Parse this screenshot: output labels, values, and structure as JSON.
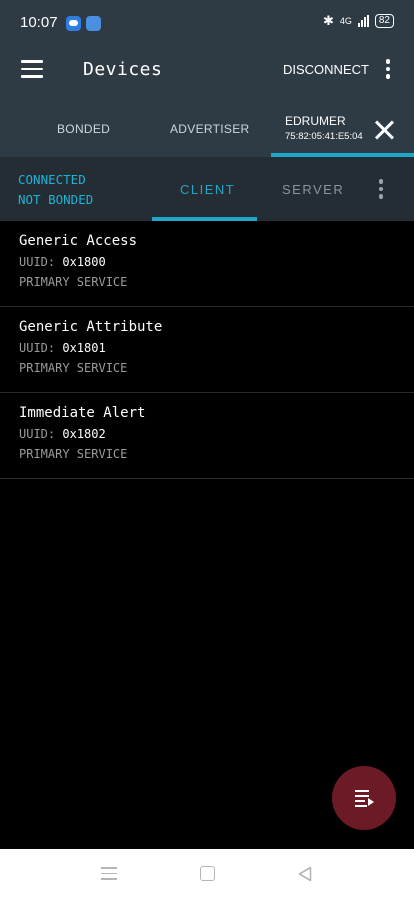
{
  "status_bar": {
    "time": "10:07",
    "network": "4G",
    "battery": "82"
  },
  "app_bar": {
    "title": "Devices",
    "disconnect_label": "DISCONNECT"
  },
  "device_tabs": [
    {
      "label": "BONDED"
    },
    {
      "label": "ADVERTISER"
    }
  ],
  "active_device": {
    "name": "EDRUMER",
    "address": "75:82:05:41:E5:04"
  },
  "connection": {
    "status": "CONNECTED",
    "bond_state": "NOT BONDED",
    "tabs": [
      {
        "label": "CLIENT",
        "active": true
      },
      {
        "label": "SERVER",
        "active": false
      }
    ]
  },
  "services": [
    {
      "name": "Generic Access",
      "uuid_label": "UUID:",
      "uuid": "0x1800",
      "type": "PRIMARY SERVICE"
    },
    {
      "name": "Generic Attribute",
      "uuid_label": "UUID:",
      "uuid": "0x1801",
      "type": "PRIMARY SERVICE"
    },
    {
      "name": "Immediate Alert",
      "uuid_label": "UUID:",
      "uuid": "0x1802",
      "type": "PRIMARY SERVICE"
    }
  ],
  "colors": {
    "app_bar": "#2e3b44",
    "accent": "#1fa7c9",
    "fab": "#6b1a26",
    "background": "#000000"
  },
  "icons": {
    "menu": "hamburger-icon",
    "more": "overflow-dots-icon",
    "close": "close-icon",
    "fab": "log-list-icon"
  }
}
